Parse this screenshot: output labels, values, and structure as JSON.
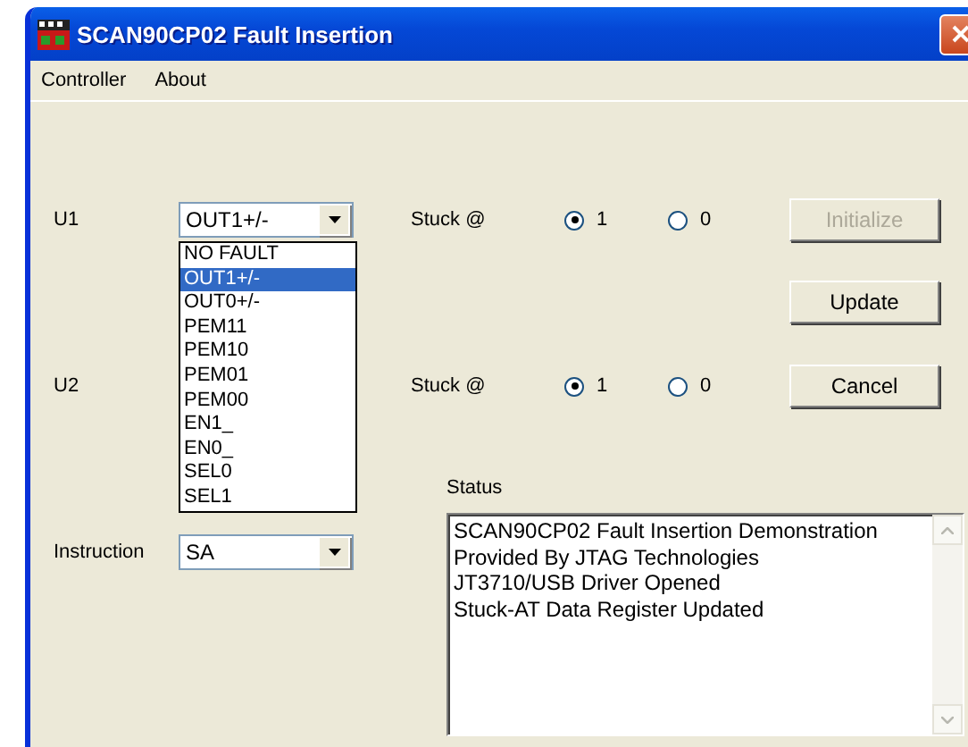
{
  "window": {
    "title": "SCAN90CP02 Fault Insertion"
  },
  "menu": [
    "Controller",
    "About"
  ],
  "u1": {
    "label": "U1",
    "value": "OUT1+/-",
    "expanded": true,
    "options": [
      {
        "label": "NO FAULT",
        "selected": false
      },
      {
        "label": "OUT1+/-",
        "selected": true
      },
      {
        "label": "OUT0+/-",
        "selected": false
      },
      {
        "label": "PEM11",
        "selected": false
      },
      {
        "label": "PEM10",
        "selected": false
      },
      {
        "label": "PEM01",
        "selected": false
      },
      {
        "label": "PEM00",
        "selected": false
      },
      {
        "label": "EN1_",
        "selected": false
      },
      {
        "label": "EN0_",
        "selected": false
      },
      {
        "label": "SEL0",
        "selected": false
      },
      {
        "label": "SEL1",
        "selected": false
      }
    ]
  },
  "u2": {
    "label": "U2"
  },
  "stuck": [
    {
      "label": "Stuck @",
      "options": [
        {
          "label": "1",
          "selected": true
        },
        {
          "label": "0",
          "selected": false
        }
      ]
    },
    {
      "label": "Stuck @",
      "options": [
        {
          "label": "1",
          "selected": true
        },
        {
          "label": "0",
          "selected": false
        }
      ]
    }
  ],
  "buttons": [
    {
      "label": "Initialize",
      "disabled": true
    },
    {
      "label": "Update",
      "disabled": false
    },
    {
      "label": "Cancel",
      "disabled": false
    }
  ],
  "instruction": {
    "label": "Instruction",
    "value": "SA"
  },
  "status": {
    "label": "Status",
    "lines": [
      "SCAN90CP02 Fault Insertion Demonstration",
      "Provided By JTAG Technologies",
      "JT3710/USB Driver Opened",
      "Stuck-AT Data Register Updated"
    ]
  }
}
